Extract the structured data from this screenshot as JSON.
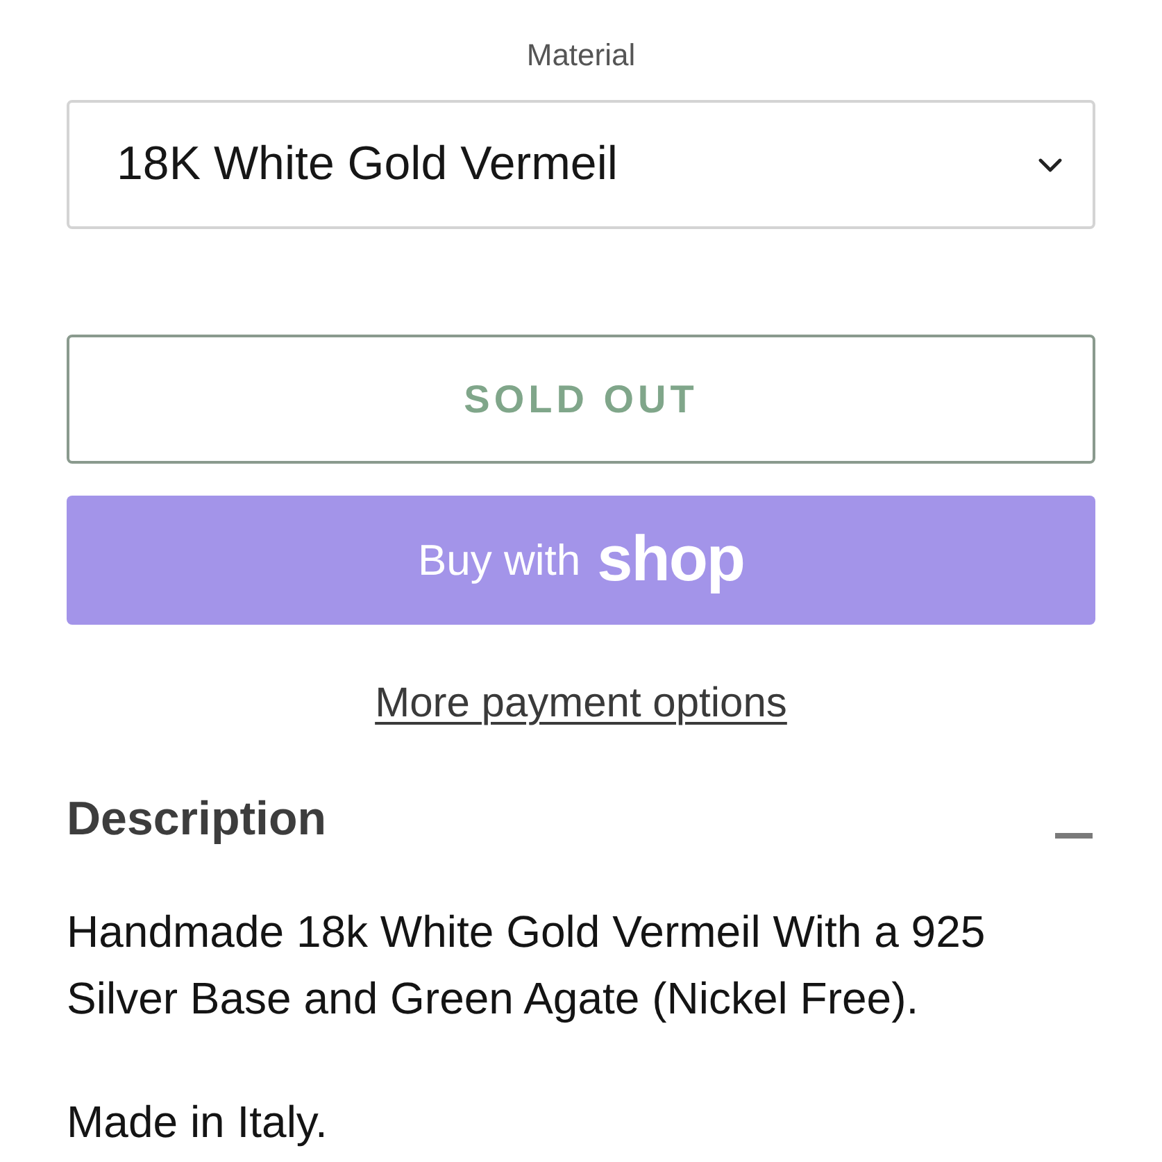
{
  "variant_selector": {
    "label": "Material",
    "value": "18K White Gold Vermeil"
  },
  "buttons": [
    {
      "kind": "outline",
      "label": "SOLD OUT"
    },
    {
      "kind": "shop_pay",
      "label": "Buy with",
      "brand": "shop"
    }
  ],
  "more_payment_link": "More payment options",
  "description": {
    "title": "Description",
    "expanded": true,
    "paragraphs": [
      "Handmade 18k White Gold Vermeil With a 925 Silver Base and Green Agate (Nickel Free).",
      "Made in Italy."
    ]
  }
}
